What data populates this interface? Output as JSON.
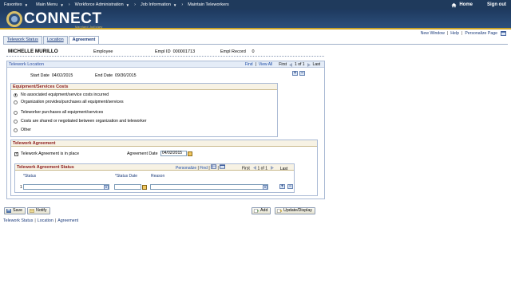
{
  "topnav": {
    "items": [
      "Favorites",
      "Main Menu",
      "Workforce Administration",
      "Job Information",
      "Maintain Teleworkers"
    ],
    "home_label": "Home",
    "signout_label": "Sign out"
  },
  "brand": {
    "name": "CONNECT",
    "tagline": "Maryland Judiciary"
  },
  "utility_links": [
    "New Window",
    "Help",
    "Personalize Page"
  ],
  "tabs": [
    "Telework Status",
    "Location",
    "Agreement"
  ],
  "active_tab": "Agreement",
  "employee": {
    "name": "MICHELLE MURILLO",
    "type": "Employee",
    "id_label": "Empl ID",
    "id_value": "000001713",
    "record_label": "Empl Record",
    "record_value": "0"
  },
  "location_section": {
    "title": "Telework Location",
    "find": "Find",
    "view_all": "View All",
    "first": "First",
    "range": "1 of 1",
    "last": "Last",
    "start_date_label": "Start Date",
    "start_date": "04/02/2015",
    "end_date_label": "End Date",
    "end_date": "09/30/2015"
  },
  "equipment": {
    "title": "Equipment/Services Costs",
    "options": [
      "No associated equipment/service costs incurred",
      "Organization provides/purchases all equipment/services",
      "Teleworker purchases all equipment/services",
      "Costs are shared or negotiated between organization and teleworker",
      "Other"
    ],
    "selected_index": 0
  },
  "agreement": {
    "title": "Telework Agreement",
    "in_place_label": "Telework Agreement is in place",
    "in_place_checked": true,
    "date_label": "Agreement Date",
    "date_value": "04/02/2015"
  },
  "status_grid": {
    "title": "Telework Agreement Status",
    "personalize": "Personalize",
    "find": "Find",
    "first": "First",
    "range": "1 of 1",
    "last": "Last",
    "columns": [
      "*Status",
      "*Status Date",
      "Reason"
    ],
    "row_number": "1"
  },
  "buttons": {
    "save": "Save",
    "notify": "Notify",
    "add": "Add",
    "update_display": "Update/Display"
  },
  "bottom_links": [
    "Telework Status",
    "Location",
    "Agreement"
  ],
  "colors": {
    "nav_bg": "#1f3a5c",
    "section_title": "#8b1a1a",
    "link": "#1a3a7a"
  }
}
